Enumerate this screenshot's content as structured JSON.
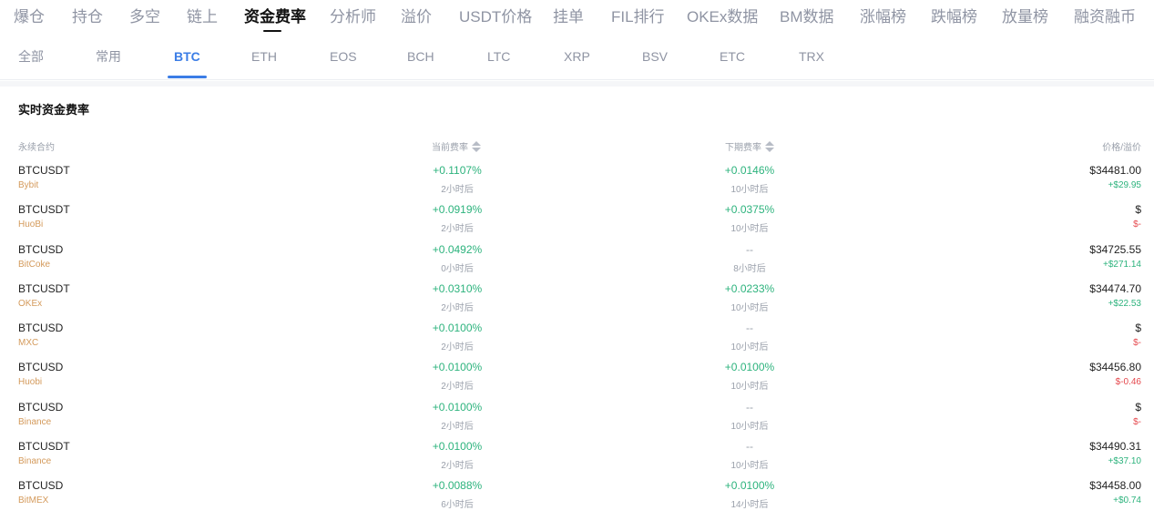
{
  "top_nav": {
    "tabs": [
      "爆仓",
      "持仓",
      "多空",
      "链上",
      "资金费率",
      "分析师",
      "溢价",
      "USDT价格",
      "挂单",
      "FIL排行",
      "OKEx数据",
      "BM数据",
      "涨幅榜",
      "跌幅榜",
      "放量榜",
      "融资融币"
    ],
    "active": "资金费率"
  },
  "sub_nav": {
    "tabs": [
      "全部",
      "常用",
      "BTC",
      "ETH",
      "EOS",
      "BCH",
      "LTC",
      "XRP",
      "BSV",
      "ETC",
      "TRX"
    ],
    "active": "BTC"
  },
  "panel": {
    "title": "实时资金费率",
    "headers": {
      "contract": "永续合约",
      "current": "当前费率",
      "next": "下期费率",
      "price": "价格/溢价"
    }
  },
  "rows": [
    {
      "symbol": "BTCUSDT",
      "exchange": "Bybit",
      "current_rate": "+0.1107%",
      "current_time": "2小时后",
      "next_rate": "+0.0146%",
      "next_time": "10小时后",
      "price": "$34481.00",
      "premium": "+$29.95",
      "premium_sign": "pos"
    },
    {
      "symbol": "BTCUSDT",
      "exchange": "HuoBi",
      "current_rate": "+0.0919%",
      "current_time": "2小时后",
      "next_rate": "+0.0375%",
      "next_time": "10小时后",
      "price": "$",
      "premium": "$-",
      "premium_sign": "neg"
    },
    {
      "symbol": "BTCUSD",
      "exchange": "BitCoke",
      "current_rate": "+0.0492%",
      "current_time": "0小时后",
      "next_rate": "--",
      "next_time": "8小时后",
      "price": "$34725.55",
      "premium": "+$271.14",
      "premium_sign": "pos"
    },
    {
      "symbol": "BTCUSDT",
      "exchange": "OKEx",
      "current_rate": "+0.0310%",
      "current_time": "2小时后",
      "next_rate": "+0.0233%",
      "next_time": "10小时后",
      "price": "$34474.70",
      "premium": "+$22.53",
      "premium_sign": "pos"
    },
    {
      "symbol": "BTCUSD",
      "exchange": "MXC",
      "current_rate": "+0.0100%",
      "current_time": "2小时后",
      "next_rate": "--",
      "next_time": "10小时后",
      "price": "$",
      "premium": "$-",
      "premium_sign": "neg"
    },
    {
      "symbol": "BTCUSD",
      "exchange": "Huobi",
      "current_rate": "+0.0100%",
      "current_time": "2小时后",
      "next_rate": "+0.0100%",
      "next_time": "10小时后",
      "price": "$34456.80",
      "premium": "$-0.46",
      "premium_sign": "neg"
    },
    {
      "symbol": "BTCUSD",
      "exchange": "Binance",
      "current_rate": "+0.0100%",
      "current_time": "2小时后",
      "next_rate": "--",
      "next_time": "10小时后",
      "price": "$",
      "premium": "$-",
      "premium_sign": "neg"
    },
    {
      "symbol": "BTCUSDT",
      "exchange": "Binance",
      "current_rate": "+0.0100%",
      "current_time": "2小时后",
      "next_rate": "--",
      "next_time": "10小时后",
      "price": "$34490.31",
      "premium": "+$37.10",
      "premium_sign": "pos"
    },
    {
      "symbol": "BTCUSD",
      "exchange": "BitMEX",
      "current_rate": "+0.0088%",
      "current_time": "6小时后",
      "next_rate": "+0.0100%",
      "next_time": "14小时后",
      "price": "$34458.00",
      "premium": "+$0.74",
      "premium_sign": "pos"
    }
  ]
}
